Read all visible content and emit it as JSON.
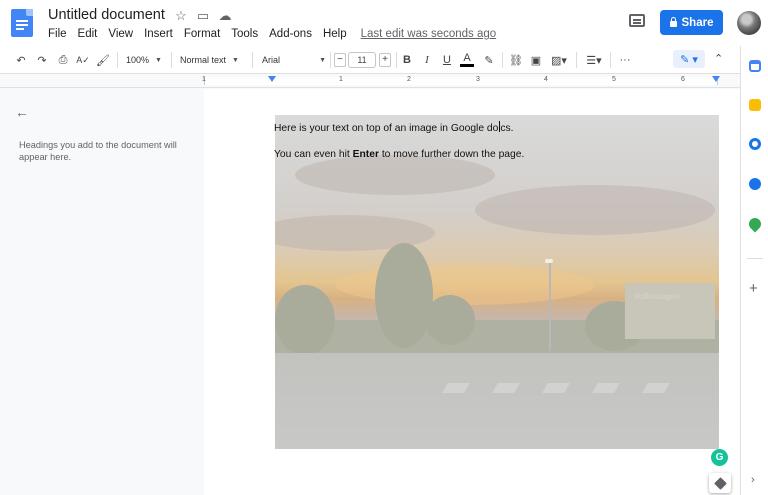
{
  "header": {
    "title": "Untitled document",
    "menu": [
      "File",
      "Edit",
      "View",
      "Insert",
      "Format",
      "Tools",
      "Add-ons",
      "Help"
    ],
    "last_edit": "Last edit was seconds ago",
    "share_label": "Share",
    "title_icons": [
      "star-icon",
      "move-to-folder-icon",
      "cloud-saved-icon"
    ]
  },
  "toolbar": {
    "zoom": "100%",
    "style": "Normal text",
    "font": "Arial",
    "font_size": "11",
    "minus": "−",
    "plus": "+",
    "more": "···"
  },
  "ruler": {
    "numbers": [
      "1",
      "1",
      "2",
      "3",
      "4",
      "5",
      "6"
    ]
  },
  "outline": {
    "hint": "Headings you add to the document will appear here."
  },
  "document": {
    "line1_before_cursor": "Here is your text on top of an image in Google do",
    "line1_after_cursor": "cs.",
    "line2_before": "You can even hit ",
    "line2_bold": "Enter",
    "line2_after": " to move further down the page.",
    "image_watermark": "Volkswagen"
  },
  "side_panel": {
    "icons": [
      "calendar-icon",
      "keep-icon",
      "tasks-icon",
      "contacts-icon",
      "maps-icon"
    ],
    "plus": "+",
    "chevron": "›"
  },
  "colors": {
    "accent": "#1a73e8",
    "docs_blue": "#4285f4",
    "grammarly": "#15c39a"
  }
}
